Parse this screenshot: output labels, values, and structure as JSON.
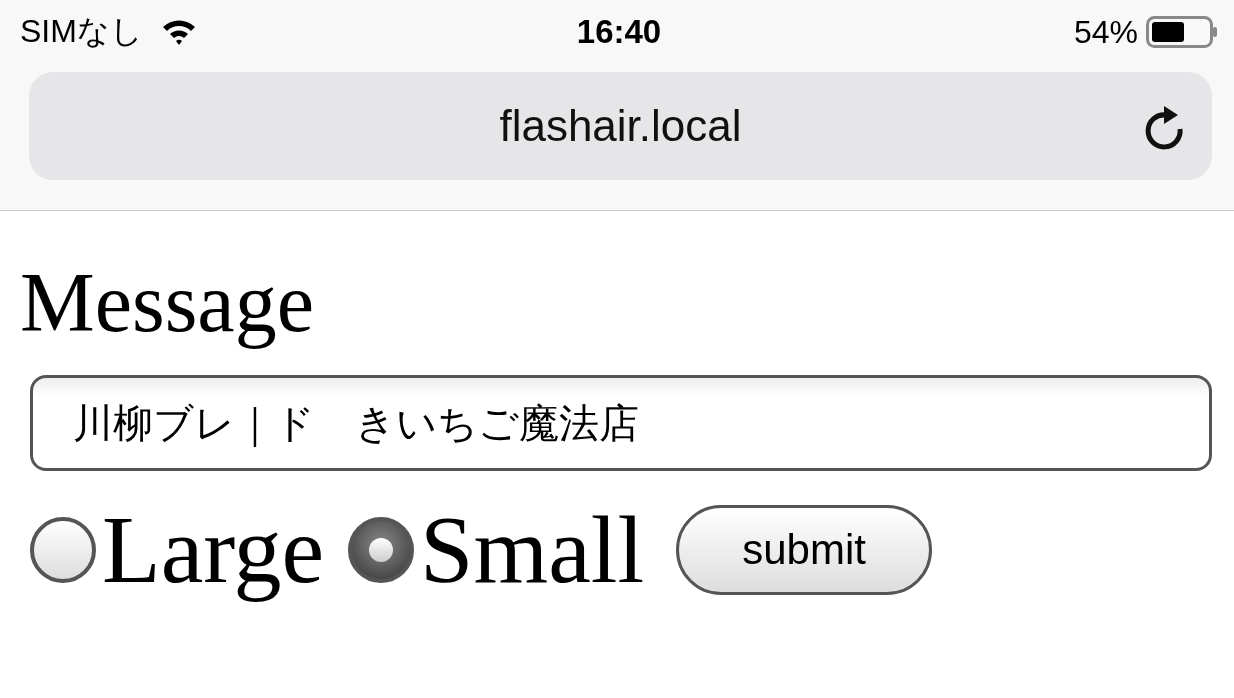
{
  "status_bar": {
    "carrier": "SIMなし",
    "time": "16:40",
    "battery": "54%"
  },
  "address_bar": {
    "url": "flashair.local"
  },
  "form": {
    "heading": "Message",
    "message_field": {
      "value": "川柳ブレ｜ド　きいちご魔法店"
    },
    "size_options": [
      {
        "label": "Large",
        "selected": false
      },
      {
        "label": "Small",
        "selected": true
      }
    ],
    "submit_button": {
      "label": "submit"
    }
  }
}
